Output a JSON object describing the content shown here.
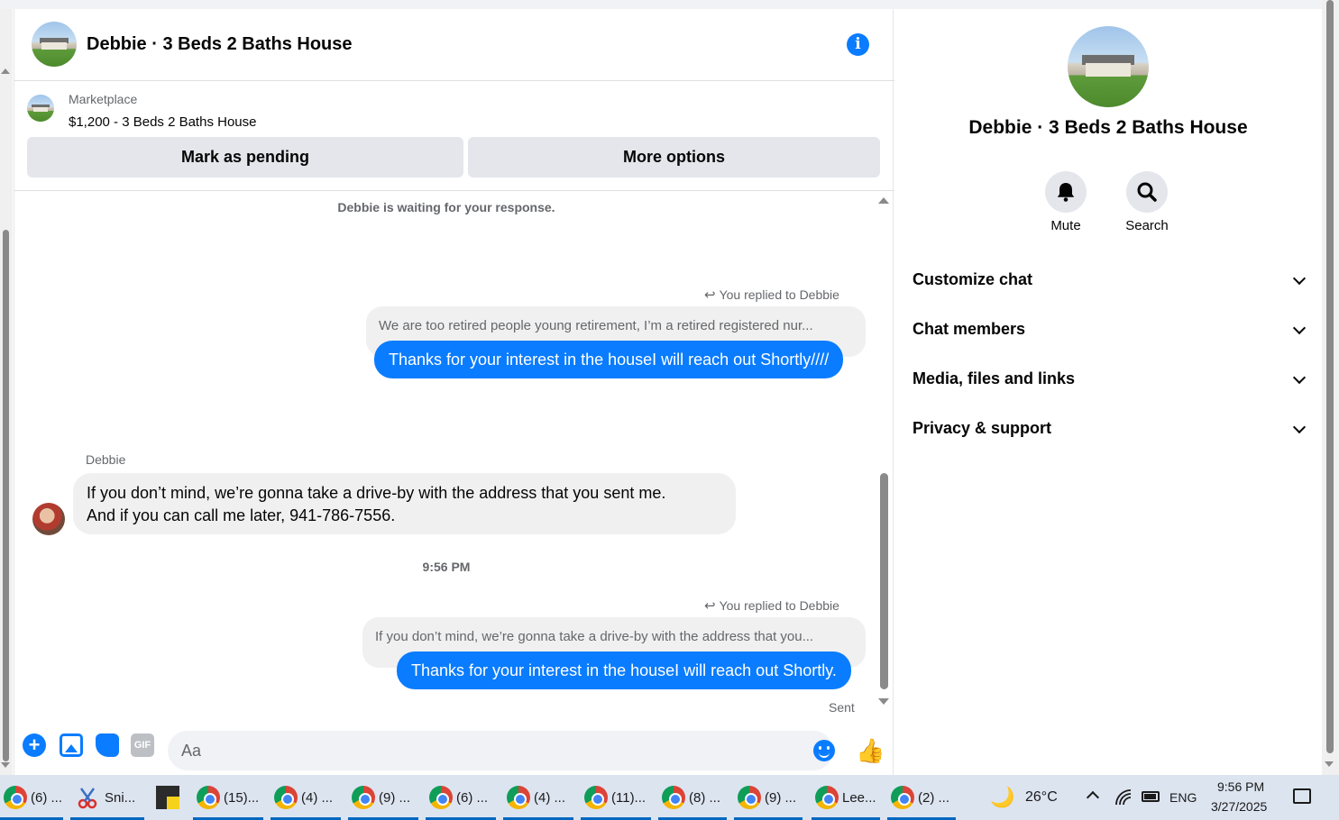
{
  "chat": {
    "title": "Debbie · 3 Beds 2 Baths House",
    "marketplace": {
      "label": "Marketplace",
      "listing": "$1,200 - 3 Beds 2 Baths House",
      "mark_pending": "Mark as pending",
      "more_options": "More options"
    },
    "system_note": "Debbie is waiting for your response.",
    "messages": {
      "reply1_label": "You replied to Debbie",
      "reply1_quote": "We are too retired people young retirement, I’m a retired registered nur...",
      "reply1_text": "Thanks for your interest in the houseI will reach out Shortly////",
      "incoming_sender": "Debbie",
      "incoming_line1": "If you don’t mind, we’re gonna take a drive-by with the address that you sent me.",
      "incoming_line2": "And if you can call me later, 941-786-7556.",
      "time_separator": "9:56 PM",
      "reply2_label": "You replied to Debbie",
      "reply2_quote": "If you don’t mind, we’re gonna take a drive-by with the address that you...",
      "reply2_text": "Thanks for your interest in the houseI will reach out Shortly.",
      "status": "Sent"
    },
    "composer": {
      "placeholder": "Aa",
      "gif_label": "GIF"
    }
  },
  "side_panel": {
    "title": "Debbie · 3 Beds 2 Baths House",
    "mute_label": "Mute",
    "search_label": "Search",
    "sections": [
      "Customize chat",
      "Chat members",
      "Media, files and links",
      "Privacy & support"
    ]
  },
  "taskbar": {
    "items": [
      "(6) ...",
      "Sni...",
      "",
      "(15)...",
      "(4) ...",
      "(9) ...",
      "(6) ...",
      "(4) ...",
      "(11)...",
      "(8) ...",
      "(9) ...",
      "Lee...",
      "(2) ..."
    ],
    "weather": "26°C",
    "language": "ENG",
    "time": "9:56 PM",
    "date": "3/27/2025"
  },
  "colors": {
    "accent": "#0a7cff",
    "bubble_gray": "#f0f0f0",
    "button_gray": "#e4e6eb"
  }
}
